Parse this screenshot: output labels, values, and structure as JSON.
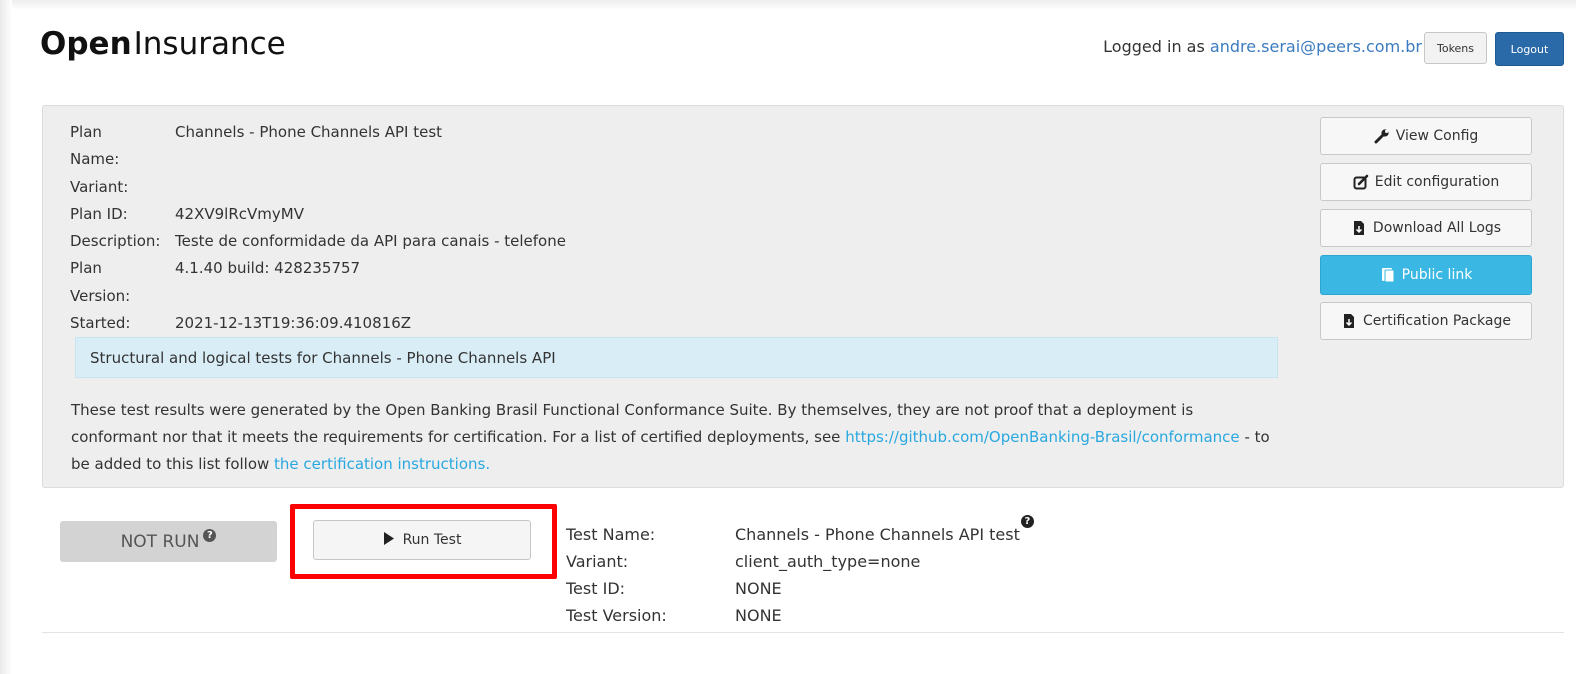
{
  "header": {
    "logo_bold": "Open",
    "logo_rest": "Insurance",
    "logged_in_prefix": "Logged in as ",
    "user_email": "andre.serai@peers.com.br",
    "tokens_label": "Tokens",
    "logout_label": "Logout"
  },
  "plan": {
    "rows": [
      {
        "label": "Plan",
        "value": "Channels - Phone Channels API test"
      },
      {
        "label": "Name:",
        "value": ""
      },
      {
        "label": "Variant:",
        "value": ""
      },
      {
        "label": "Plan ID:",
        "value": "42XV9lRcVmyMV"
      },
      {
        "label": "Description:",
        "value": "Teste de conformidade da API para canais - telefone"
      },
      {
        "label": "Plan",
        "value": "4.1.40 build: 428235757"
      },
      {
        "label": "Version:",
        "value": ""
      },
      {
        "label": "Started:",
        "value": "2021-12-13T19:36:09.410816Z"
      }
    ],
    "summary": "Structural and logical tests for Channels - Phone Channels API",
    "disclaimer": {
      "text1": "These test results were generated by the Open Banking Brasil Functional Conformance Suite. By themselves, they are not proof that a deployment is conformant nor that it meets the requirements for certification. For a list of certified deployments, see ",
      "link1": "https://github.com/OpenBanking-Brasil/conformance",
      "text2": " - to be added to this list follow ",
      "link2": "the certification instructions."
    }
  },
  "actions": {
    "view_config": {
      "label": "View Config",
      "icon": "wrench-icon"
    },
    "edit_configuration": {
      "label": "Edit configuration",
      "icon": "edit-icon"
    },
    "download_all_logs": {
      "label": "Download All Logs",
      "icon": "file-download-icon"
    },
    "public_link": {
      "label": "Public link",
      "icon": "copy-icon"
    },
    "certification_package": {
      "label": "Certification Package",
      "icon": "file-download-icon"
    }
  },
  "test": {
    "status": "NOT RUN",
    "run_label": "Run Test",
    "fields": [
      {
        "label": "Test Name:",
        "value": "Channels - Phone Channels API test"
      },
      {
        "label": "Variant:",
        "value": "client_auth_type=none"
      },
      {
        "label": "Test ID:",
        "value": "NONE"
      },
      {
        "label": "Test Version:",
        "value": "NONE"
      }
    ]
  },
  "colors": {
    "primary": "#2a6aa8",
    "info": "#3ab8e3",
    "link": "#29a8e0",
    "highlight": "#ff0000",
    "panel_bg": "#eeeeee",
    "summary_bg": "#d9edf7"
  }
}
